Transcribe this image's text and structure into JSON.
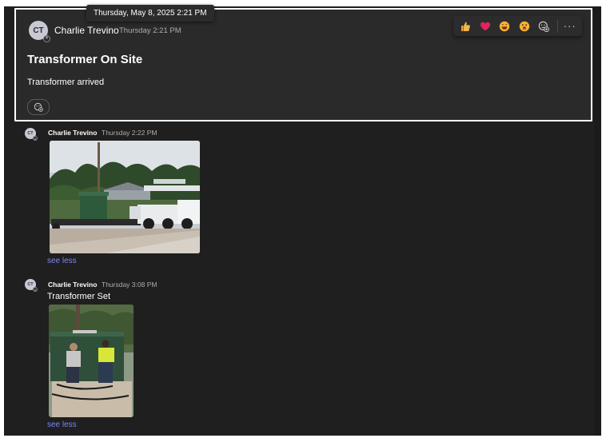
{
  "tooltip": "Thursday, May 8, 2025 2:21 PM",
  "focused_message": {
    "avatar_initials": "CT",
    "sender": "Charlie Trevino",
    "time": "Thursday 2:21 PM",
    "subject": "Transformer On Site",
    "body": "Transformer arrived"
  },
  "reaction_bar": {
    "items": [
      "like-icon",
      "heart-icon",
      "laugh-icon",
      "surprised-icon",
      "add-reaction-icon"
    ],
    "more_label": "···"
  },
  "messages": [
    {
      "avatar_initials": "CT",
      "sender": "Charlie Trevino",
      "time": "Thursday 2:22 PM",
      "see_less": "see less"
    },
    {
      "avatar_initials": "CT",
      "sender": "Charlie Trevino",
      "time": "Thursday 3:08 PM",
      "text": "Transformer Set",
      "see_less": "see less"
    }
  ],
  "colors": {
    "background": "#1f1f1f",
    "focused_background": "#2a2a2a",
    "link": "#7f85f5"
  }
}
